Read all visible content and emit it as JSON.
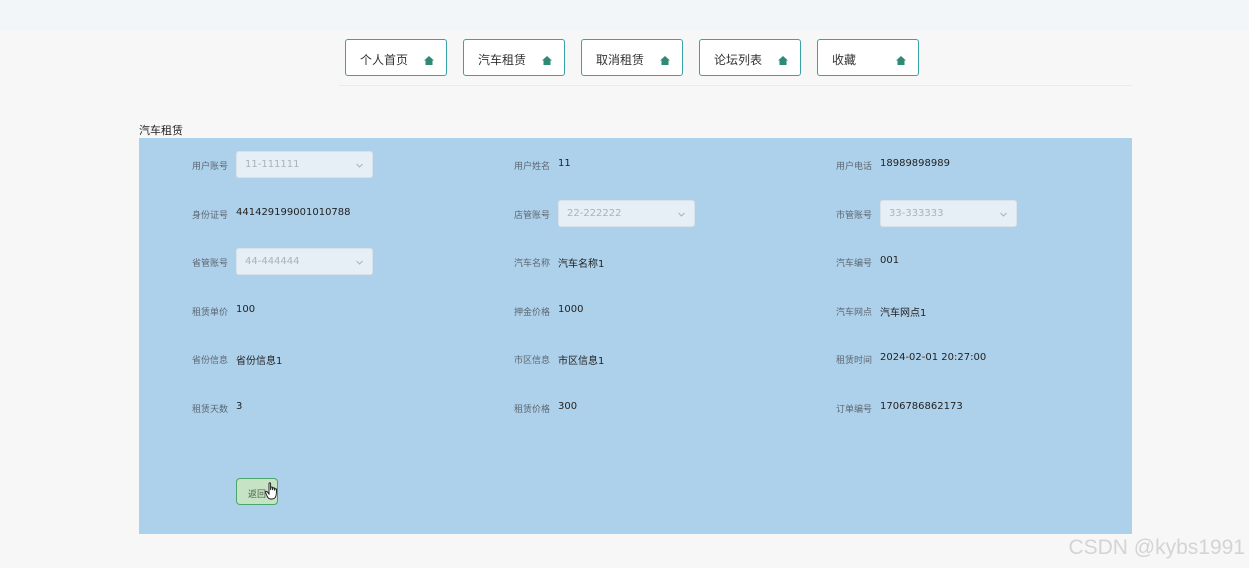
{
  "nav": {
    "items": [
      {
        "label": "个人首页",
        "icon": "home-icon"
      },
      {
        "label": "汽车租赁",
        "icon": "home-icon"
      },
      {
        "label": "取消租赁",
        "icon": "home-icon"
      },
      {
        "label": "论坛列表",
        "icon": "home-icon"
      },
      {
        "label": "收藏",
        "icon": "home-icon"
      }
    ]
  },
  "page": {
    "title": "汽车租赁"
  },
  "form": {
    "yonghuzhanghao": {
      "label": "用户账号",
      "value": "11-111111"
    },
    "yonghuxingming": {
      "label": "用户姓名",
      "value": "11"
    },
    "yonghudianhua": {
      "label": "用户电话",
      "value": "18989898989"
    },
    "shenfenzheng": {
      "label": "身份证号",
      "value": "441429199001010788"
    },
    "dianguanzhanghao": {
      "label": "店管账号",
      "value": "22-222222"
    },
    "shiguanzhanghao": {
      "label": "市管账号",
      "value": "33-333333"
    },
    "shengguanzhanghao": {
      "label": "省管账号",
      "value": "44-444444"
    },
    "qichemingcheng": {
      "label": "汽车名称",
      "value": "汽车名称1"
    },
    "qichebianhao": {
      "label": "汽车编号",
      "value": "001"
    },
    "zulindanjia": {
      "label": "租赁单价",
      "value": "100"
    },
    "yajinjiage": {
      "label": "押金价格",
      "value": "1000"
    },
    "qichewangdian": {
      "label": "汽车网点",
      "value": "汽车网点1"
    },
    "shengfenxinxi": {
      "label": "省份信息",
      "value": "省份信息1"
    },
    "shiquxinxi": {
      "label": "市区信息",
      "value": "市区信息1"
    },
    "zulinshijian": {
      "label": "租赁时间",
      "value": "2024-02-01 20:27:00"
    },
    "zulintianshu": {
      "label": "租赁天数",
      "value": "3"
    },
    "zulinjiage": {
      "label": "租赁价格",
      "value": "300"
    },
    "dingdanbianhao": {
      "label": "订单编号",
      "value": "1706786862173"
    }
  },
  "actions": {
    "back_label": "返回"
  },
  "watermark": "CSDN @kybs1991",
  "colors": {
    "accent": "#37a3a7",
    "panel": "#aed1eb",
    "back_button": "#c6e3c3"
  }
}
